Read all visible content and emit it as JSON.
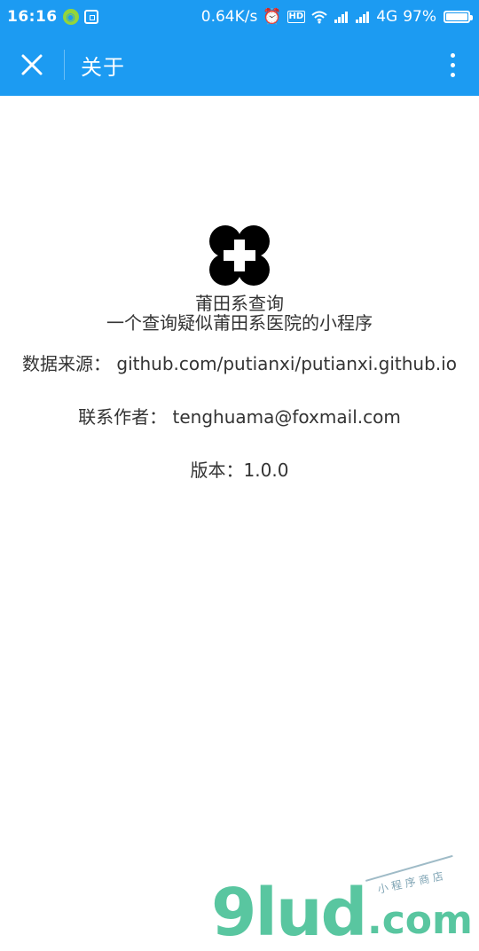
{
  "status_bar": {
    "time": "16:16",
    "network_speed": "0.64K/s",
    "network_type": "4G",
    "hd_label": "HD",
    "battery_percent": "97%",
    "icons": {
      "wechat_badge": "wechat-badge-icon",
      "scan": "scan-icon",
      "alarm": "alarm-icon",
      "wifi": "wifi-icon",
      "signal": "signal-icon",
      "battery": "battery-icon"
    }
  },
  "navbar": {
    "title": "关于",
    "icons": {
      "close": "close-icon",
      "more": "more-vertical-icon"
    }
  },
  "about": {
    "app_name": "莆田系查询",
    "description": "一个查询疑似莆田系医院的小程序",
    "data_source_label": "数据来源：",
    "data_source_value": "github.com/putianxi/putianxi.github.io",
    "author_label": "联系作者：",
    "author_value": "tenghuama@foxmail.com",
    "version_label": "版本：",
    "version_value": "1.0.0"
  },
  "watermark": {
    "main": "9lud",
    "domain": ".com",
    "tagline": "小 程 序 商 店"
  },
  "colors": {
    "navbar_bg": "#1c9bf2",
    "content_text": "#333333",
    "watermark_green": "#59c6a0"
  }
}
